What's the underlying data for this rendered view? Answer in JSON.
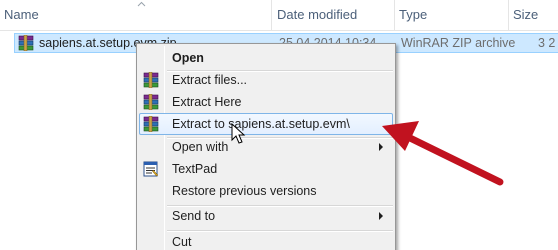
{
  "columns": {
    "name": "Name",
    "date_modified": "Date modified",
    "type": "Type",
    "size": "Size"
  },
  "file": {
    "name": "sapiens.at.setup.evm.zip",
    "date": "25.04.2014 10:34",
    "type": "WinRAR ZIP archive",
    "size": "3 2",
    "icon": "winrar-archive-icon"
  },
  "menu": {
    "items": [
      {
        "label": "Open",
        "bold": true
      },
      {
        "label": "Extract files...",
        "icon": "winrar-icon"
      },
      {
        "label": "Extract Here",
        "icon": "winrar-icon"
      },
      {
        "label": "Extract to sapiens.at.setup.evm\\",
        "icon": "winrar-icon",
        "highlighted": true
      },
      {
        "label": "Open with",
        "submenu": true
      },
      {
        "label": "TextPad",
        "icon": "textpad-icon"
      },
      {
        "label": "Restore previous versions"
      },
      {
        "label": "Send to",
        "submenu": true
      },
      {
        "label": "Cut"
      }
    ]
  },
  "colors": {
    "selection": "#cde8ff",
    "menu_highlight_border": "#7fb5e8",
    "arrow": "#c1121f"
  }
}
